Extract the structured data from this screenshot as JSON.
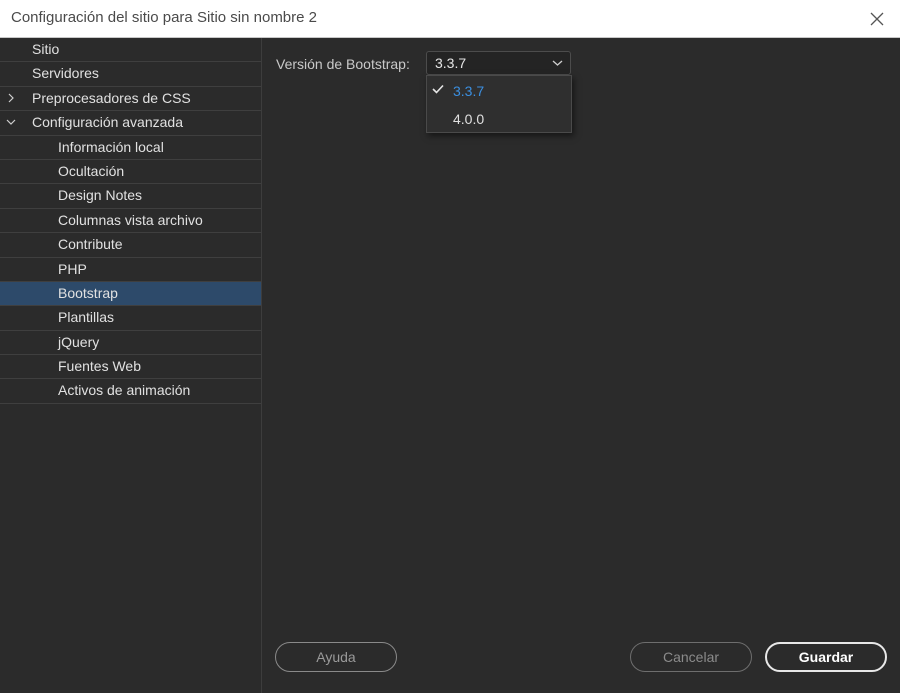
{
  "window": {
    "title": "Configuración del sitio para Sitio sin nombre 2",
    "close_icon": "close-icon"
  },
  "sidebar": {
    "items": [
      {
        "label": "Sitio",
        "level": 0,
        "expander": null,
        "selected": false
      },
      {
        "label": "Servidores",
        "level": 0,
        "expander": null,
        "selected": false
      },
      {
        "label": "Preprocesadores de CSS",
        "level": 0,
        "expander": "collapsed",
        "selected": false
      },
      {
        "label": "Configuración avanzada",
        "level": 0,
        "expander": "expanded",
        "selected": false
      },
      {
        "label": "Información local",
        "level": 1,
        "expander": null,
        "selected": false
      },
      {
        "label": "Ocultación",
        "level": 1,
        "expander": null,
        "selected": false
      },
      {
        "label": "Design Notes",
        "level": 1,
        "expander": null,
        "selected": false
      },
      {
        "label": "Columnas vista archivo",
        "level": 1,
        "expander": null,
        "selected": false
      },
      {
        "label": "Contribute",
        "level": 1,
        "expander": null,
        "selected": false
      },
      {
        "label": "PHP",
        "level": 1,
        "expander": null,
        "selected": false
      },
      {
        "label": "Bootstrap",
        "level": 1,
        "expander": null,
        "selected": true
      },
      {
        "label": "Plantillas",
        "level": 1,
        "expander": null,
        "selected": false
      },
      {
        "label": "jQuery",
        "level": 1,
        "expander": null,
        "selected": false
      },
      {
        "label": "Fuentes Web",
        "level": 1,
        "expander": null,
        "selected": false
      },
      {
        "label": "Activos de animación",
        "level": 1,
        "expander": null,
        "selected": false
      }
    ]
  },
  "bootstrap": {
    "version_label": "Versión de Bootstrap:",
    "selected_version": "3.3.7",
    "options": [
      {
        "label": "3.3.7",
        "selected": true
      },
      {
        "label": "4.0.0",
        "selected": false
      }
    ]
  },
  "buttons": {
    "help": "Ayuda",
    "cancel": "Cancelar",
    "save": "Guardar"
  },
  "colors": {
    "selected_row": "#2d4a6a",
    "selected_option_text": "#3b8fe0",
    "background": "#2b2b2b"
  }
}
